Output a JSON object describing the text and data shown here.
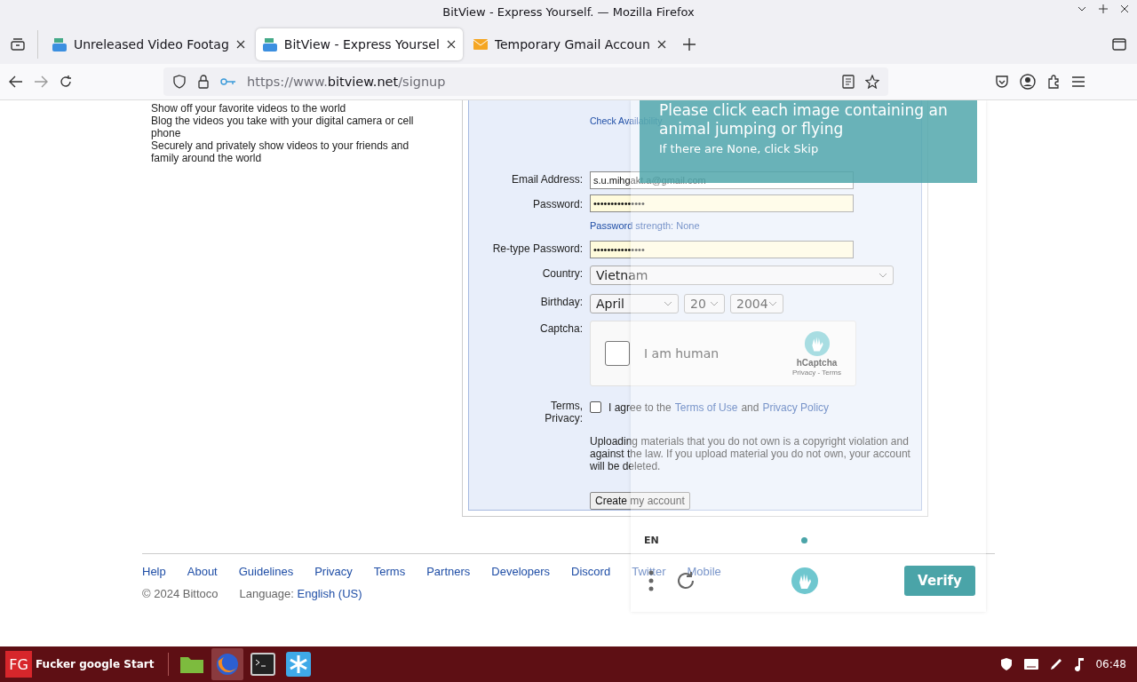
{
  "window": {
    "title": "BitView - Express Yourself. — Mozilla Firefox"
  },
  "tabs": [
    {
      "title": "Unreleased Video Footag",
      "kind": "site",
      "selected": false
    },
    {
      "title": "BitView - Express Yoursel",
      "kind": "site",
      "selected": true
    },
    {
      "title": "Temporary Gmail Accoun",
      "kind": "mail",
      "selected": false
    }
  ],
  "toolbar": {
    "back_disabled": false,
    "forward_disabled": true,
    "url": {
      "prefix": "https://www.",
      "host": "bitview.net",
      "path": "/signup"
    }
  },
  "features": [
    "Show off your favorite videos to the world",
    "Blog the videos you take with your digital camera or cell phone",
    "Securely and privately show videos to your friends and family around the world"
  ],
  "form": {
    "check_link": "Check Availability",
    "email": {
      "label": "Email Address:",
      "value": "s.u.mihgakt.a@gmail.com"
    },
    "password": {
      "label": "Password:",
      "value": "•••••••••••••••"
    },
    "strength": "Password strength: None",
    "retype": {
      "label": "Re-type Password:",
      "value": "•••••••••••••••"
    },
    "country": {
      "label": "Country:",
      "value": "Vietnam"
    },
    "birthday": {
      "label": "Birthday:",
      "month": "April",
      "day": "20",
      "year": "2004"
    },
    "captcha": {
      "label": "Captcha:",
      "checked": false,
      "text": "I am human",
      "brand": "hCaptcha",
      "links": "Privacy - Terms"
    },
    "terms": {
      "label": "Terms, Privacy:",
      "checked": false,
      "prefix": "I agree to the",
      "link1": "Terms of Use",
      "middle": "and",
      "link2": "Privacy Policy"
    },
    "notice": "Uploading materials that you do not own is a copyright violation and against the law. If you upload material you do not own, your account will be deleted.",
    "submit": "Create my account"
  },
  "footer": {
    "links": [
      "Help",
      "About",
      "Guidelines",
      "Privacy",
      "Terms",
      "Partners",
      "Developers",
      "Discord",
      "Twitter",
      "Mobile"
    ],
    "copyright": "© 2024 Bittoco",
    "language_label": "Language:",
    "language": "English (US)"
  },
  "challenge": {
    "prompt": "Please click each image containing an animal jumping or flying",
    "hint": "If there are None, click Skip",
    "language": "EN",
    "verify": "Verify"
  },
  "taskbar": {
    "logo": "FG",
    "start": "Fucker google Start",
    "apps": [
      {
        "kind": "folder",
        "active": false
      },
      {
        "kind": "browser",
        "active": true
      },
      {
        "kind": "terminal",
        "active": false
      },
      {
        "kind": "app",
        "active": false
      }
    ],
    "clock": "06:48"
  }
}
